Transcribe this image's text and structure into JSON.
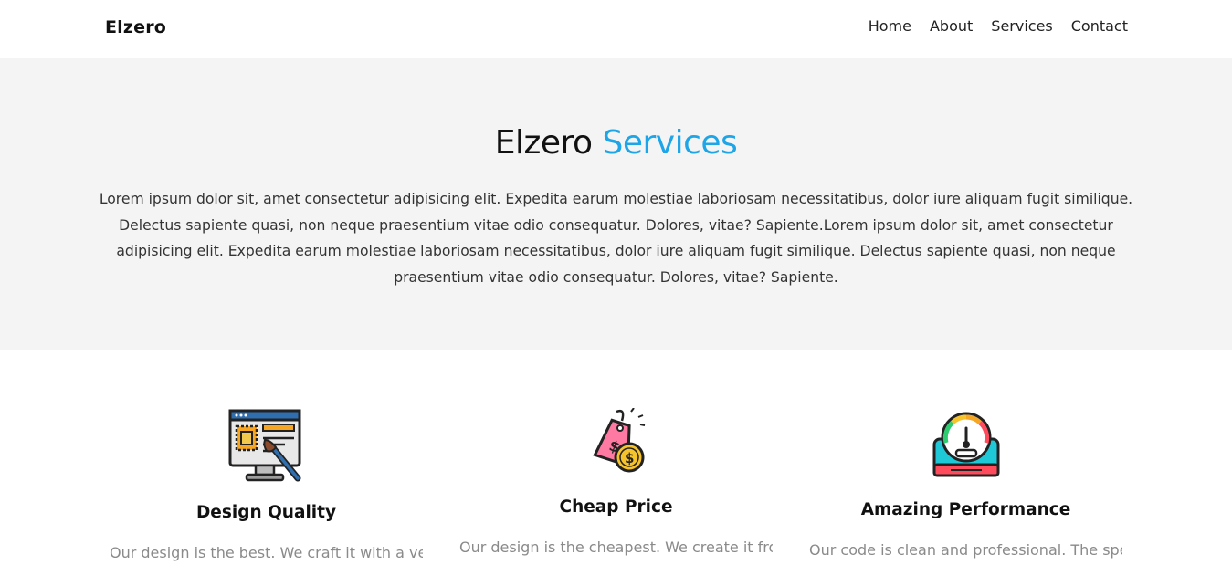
{
  "header": {
    "logo": "Elzero",
    "nav": [
      "Home",
      "About",
      "Services",
      "Contact"
    ]
  },
  "hero": {
    "title_main": "Elzero",
    "title_accent": "Services",
    "text": "Lorem ipsum dolor sit, amet consectetur adipisicing elit. Expedita earum molestiae laboriosam necessitatibus, dolor iure aliquam fugit similique. Delectus sapiente quasi, non neque praesentium vitae odio consequatur. Dolores, vitae? Sapiente.Lorem ipsum dolor sit, amet consectetur adipisicing elit. Expedita earum molestiae laboriosam necessitatibus, dolor iure aliquam fugit similique. Delectus sapiente quasi, non neque praesentium vitae odio consequatur. Dolores, vitae? Sapiente."
  },
  "features": [
    {
      "icon": "design-monitor-icon",
      "title": "Design Quality",
      "text": "Our design is the best. We craft it with a very"
    },
    {
      "icon": "price-tag-icon",
      "title": "Cheap Price",
      "text": "Our design is the cheapest. We create it from"
    },
    {
      "icon": "speed-gauge-icon",
      "title": "Amazing Performance",
      "text": "Our code is clean and professional. The speed"
    }
  ],
  "colors": {
    "accent": "#1da5e8",
    "hero_background": "#f4f4f4",
    "muted_text": "#8a8a8a"
  }
}
